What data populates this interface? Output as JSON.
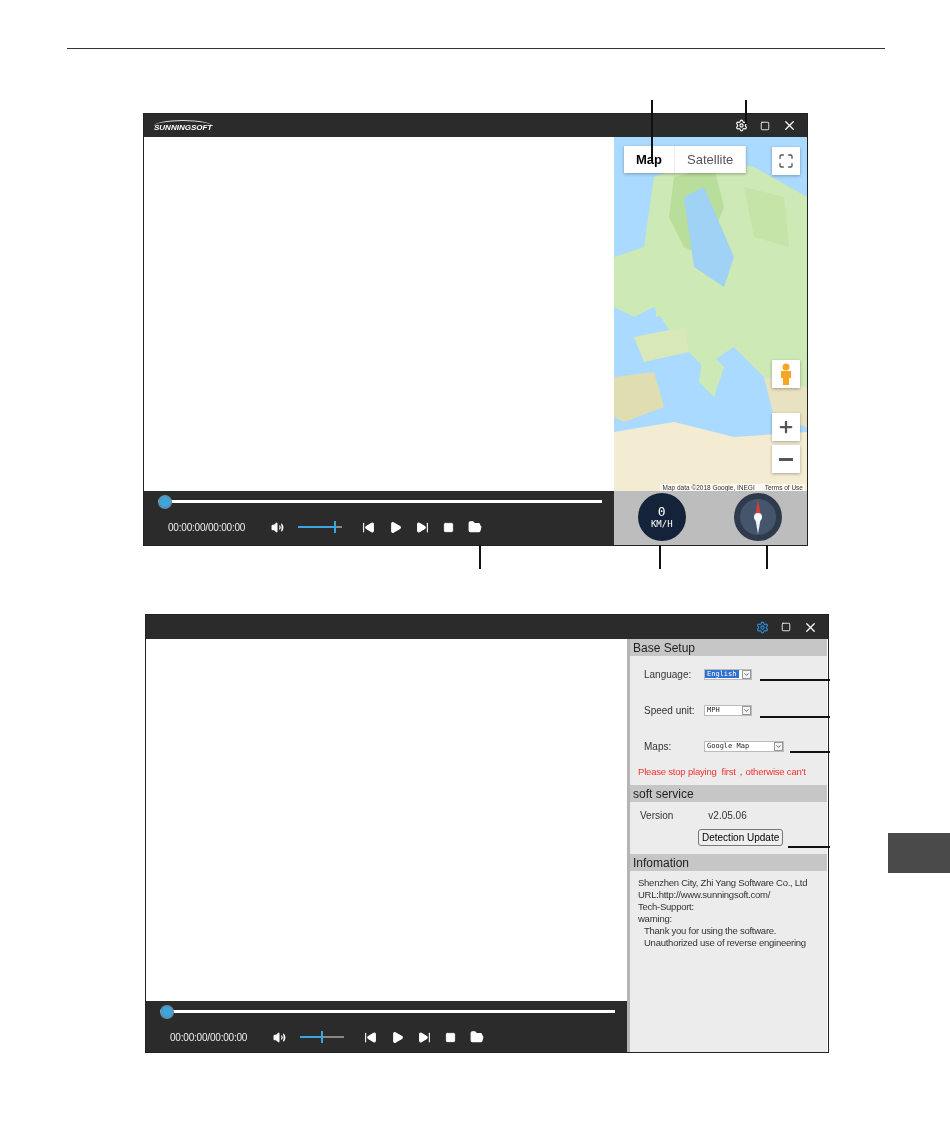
{
  "windows": [
    {
      "kind": "map_player",
      "title_bar": {
        "logo_text": "SUNNINGSOFT",
        "settings_active": false
      },
      "map": {
        "tabs": [
          {
            "label": "Map",
            "selected": true
          },
          {
            "label": "Satellite",
            "selected": false
          }
        ],
        "attribution": "Map data ©2018 Google, INEGI",
        "terms": "Terms of Use"
      },
      "player": {
        "time": "00:00:00/00:00:00",
        "progress": {
          "level": 0
        },
        "volume": {
          "level": 0.85
        }
      },
      "speedometer": {
        "value": "0",
        "unit": "KM/H"
      }
    },
    {
      "kind": "settings_player",
      "title_bar": {
        "settings_active": true
      },
      "player": {
        "time": "00:00:00/00:00:00",
        "progress": {
          "level": 0
        },
        "volume": {
          "level": 0.5
        }
      },
      "settings": {
        "base_setup": {
          "title": "Base Setup",
          "fields": [
            {
              "label": "Language:",
              "value": "English",
              "highlighted": true,
              "wide": false
            },
            {
              "label": "Speed unit:",
              "value": "MPH",
              "highlighted": false,
              "wide": false
            },
            {
              "label": "Maps:",
              "value": "Google Map",
              "highlighted": false,
              "wide": true
            }
          ],
          "warning": "Please stop playing  first，otherwise can't"
        },
        "soft_service": {
          "title": "soft service",
          "version_label": "Version",
          "version": "v2.05.06",
          "button": "Detection Update"
        },
        "information": {
          "title": "Infomation",
          "lines": [
            {
              "text": "Shenzhen City, Zhi Yang Software Co., Ltd",
              "indented": false
            },
            {
              "text": "URL:http://www.sunningsoft.com/",
              "indented": false
            },
            {
              "text": "Tech-Support:",
              "indented": false
            },
            {
              "text": "warning:",
              "indented": false
            },
            {
              "text": "Thank you for using the software.",
              "indented": true
            },
            {
              "text": "Unauthorized use of reverse engineering",
              "indented": true
            }
          ]
        }
      }
    }
  ]
}
